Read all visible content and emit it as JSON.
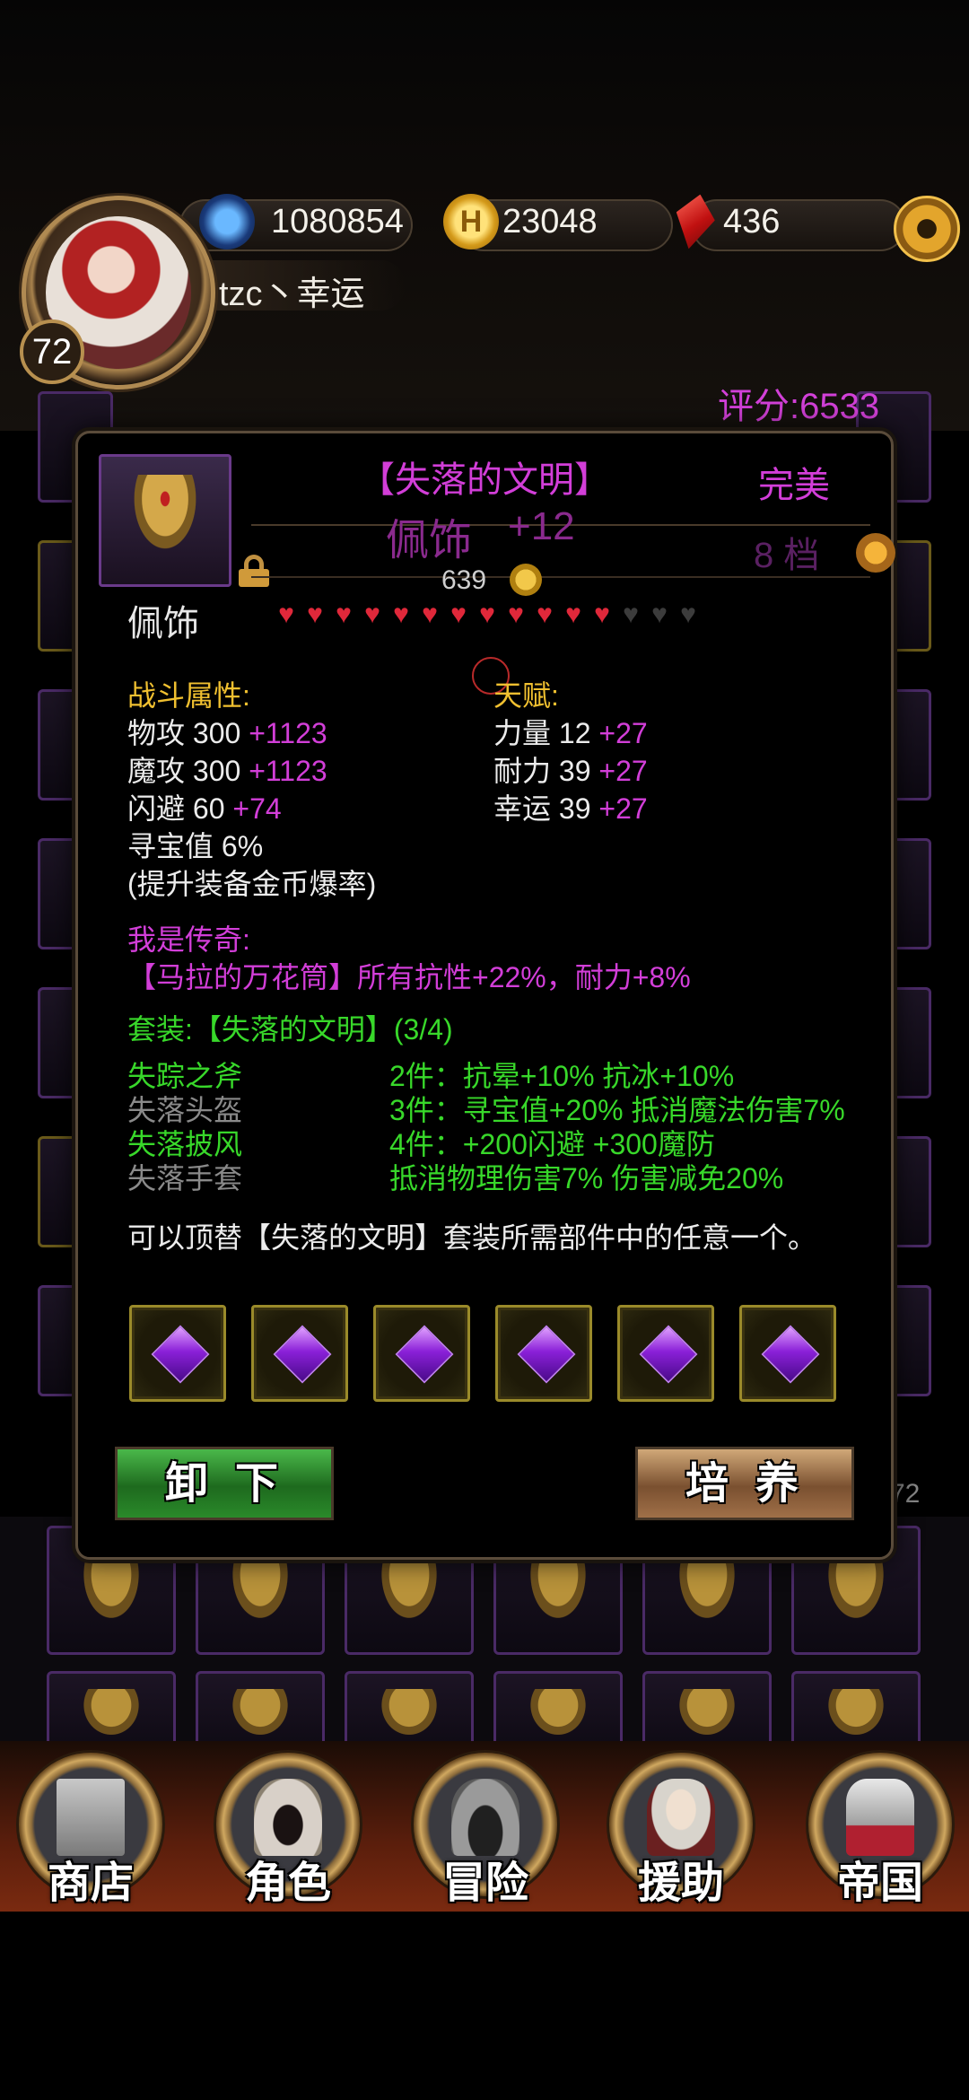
{
  "header": {
    "exp_value": "1080854",
    "gold_value": "23048",
    "gem_value": "436",
    "player_name": "tzc丶幸运",
    "level": "72",
    "icons": {
      "exp": "exp-orb-icon",
      "gold": "gold-coin-icon",
      "gem": "red-crystal-icon",
      "settings": "gear-icon"
    }
  },
  "score_text": "评分:6533",
  "item": {
    "name": "【失落的文明】",
    "type": "佩饰",
    "plus": "+12",
    "quality": "完美",
    "grade": "8 档",
    "price": "639",
    "slot_name": "佩饰",
    "hearts_filled": 12,
    "hearts_total": 15,
    "combat_header": "战斗属性:",
    "talent_header": "天赋:",
    "combat_stats": [
      {
        "base": "物攻 300",
        "bonus": "+1123"
      },
      {
        "base": "魔攻 300",
        "bonus": "+1123"
      },
      {
        "base": "闪避 60",
        "bonus": "+74"
      },
      {
        "base": "寻宝值 6%",
        "bonus": ""
      }
    ],
    "treasure_note": "(提升装备金币爆率)",
    "talents": [
      {
        "base": "力量 12",
        "bonus": "+27"
      },
      {
        "base": "耐力 39",
        "bonus": "+27"
      },
      {
        "base": "幸运 39",
        "bonus": "+27"
      }
    ],
    "legend_header": "我是传奇:",
    "legend_text": "【马拉的万花筒】所有抗性+22%，耐力+8%",
    "set_header": "套装:【失落的文明】(3/4)",
    "set_pieces": [
      {
        "name": "失踪之斧",
        "owned": true
      },
      {
        "name": "失落头盔",
        "owned": false
      },
      {
        "name": "失落披风",
        "owned": true
      },
      {
        "name": "失落手套",
        "owned": false
      }
    ],
    "set_bonuses": [
      "2件：抗晕+10% 抗冰+10%",
      "3件：寻宝值+20% 抵消魔法伤害7%",
      "4件：+200闪避 +300魔防",
      "抵消物理伤害7% 伤害减免20%"
    ],
    "replace_note": "可以顶替【失落的文明】套装所需部件中的任意一个。",
    "gem_slots": 6
  },
  "actions": {
    "unequip_label": "卸下",
    "train_label": "培养"
  },
  "background": {
    "count_text": "72"
  },
  "nav": [
    {
      "label": "商店",
      "icon": "castle-icon"
    },
    {
      "label": "角色",
      "icon": "hooded-figure-icon"
    },
    {
      "label": "冒险",
      "icon": "dungeon-gate-icon"
    },
    {
      "label": "援助",
      "icon": "companion-portrait-icon"
    },
    {
      "label": "帝国",
      "icon": "crown-icon"
    }
  ],
  "colors": {
    "accent_magenta": "#d23ed8",
    "stat_yellow": "#f0c030",
    "set_green": "#38d82a",
    "heart_red": "#e0283a"
  }
}
